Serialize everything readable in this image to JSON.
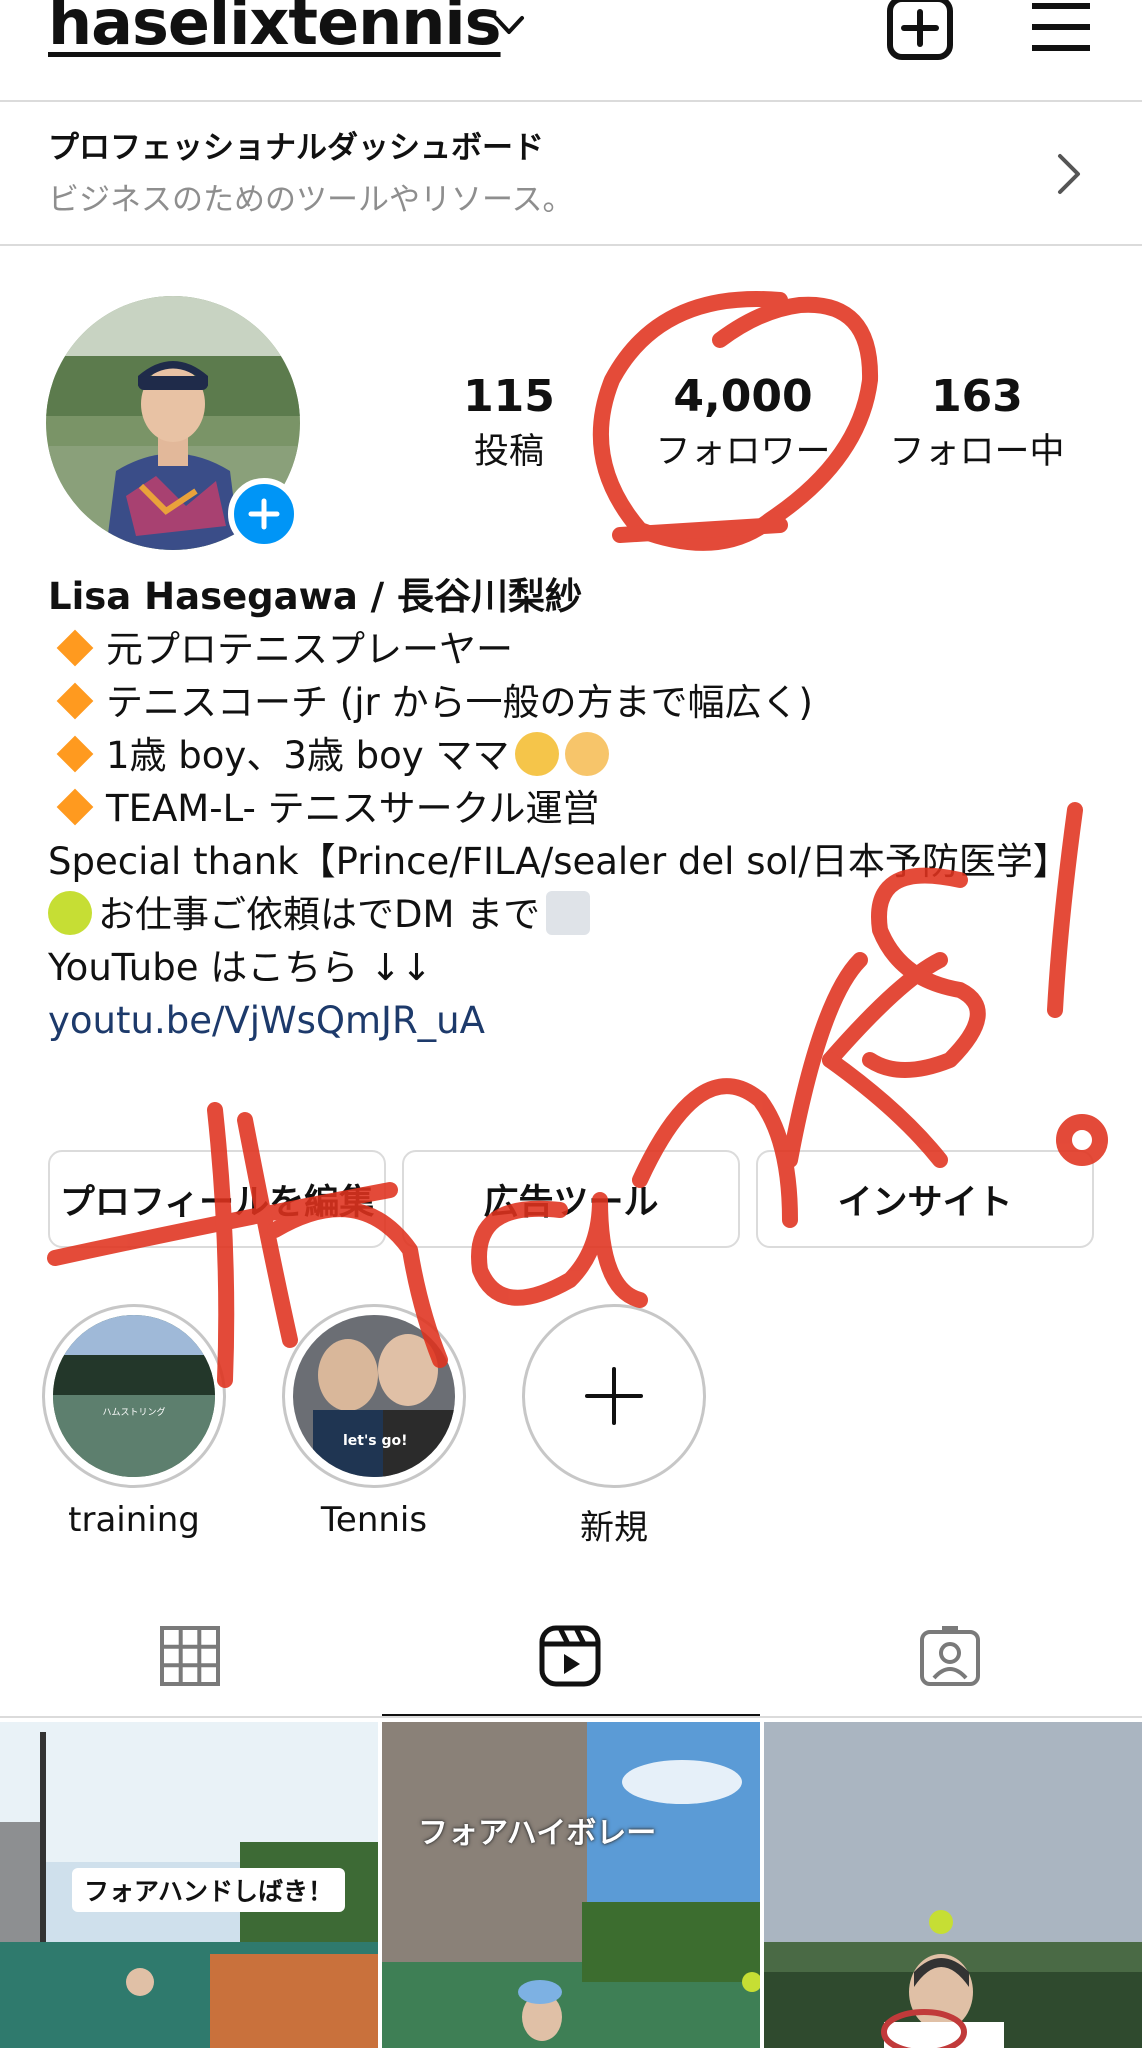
{
  "header": {
    "username": "haselixtennis",
    "icons": [
      "chevron-down-icon",
      "new-post-icon",
      "menu-icon"
    ]
  },
  "dashboard": {
    "title": "プロフェッショナルダッシュボード",
    "subtitle": "ビジネスのためのツールやリソース。"
  },
  "stats": {
    "posts": {
      "value": "115",
      "label": "投稿"
    },
    "followers": {
      "value": "4,000",
      "label": "フォロワー"
    },
    "following": {
      "value": "163",
      "label": "フォロー中"
    }
  },
  "bio": {
    "name": "Lisa Hasegawa / 長谷川梨紗",
    "line1": "元プロテニスプレーヤー",
    "line2": "テニスコーチ (jr から一般の方まで幅広く)",
    "line3": "1歳 boy、3歳 boy ママ",
    "line4": "TEAM-L- テニスサークル運営",
    "line5": "Special thank【Prince/FILA/sealer del sol/日本予防医学】",
    "line6": "お仕事ご依頼はでDM まで",
    "line7": "YouTube はこちら ↓↓",
    "link": "youtu.be/VjWsQmJR_uA"
  },
  "buttons": {
    "edit": "プロフィールを編集",
    "ads": "広告ツール",
    "insights": "インサイト"
  },
  "highlights": [
    {
      "label": "training"
    },
    {
      "label": "Tennis"
    },
    {
      "label": "新規"
    }
  ],
  "tabs": [
    "grid-icon",
    "reels-icon",
    "tagged-icon"
  ],
  "reels": [
    {
      "caption": "フォアハンドしばき！"
    },
    {
      "caption": "フォアハイボレー"
    },
    {
      "caption": ""
    }
  ],
  "overlay": {
    "handwriting": "Thanks!",
    "color": "#e0321e"
  },
  "colors": {
    "accent_blue": "#0095f6",
    "link": "#1d3a6b",
    "muted": "#8e8e8e",
    "border": "#dbdbdb"
  }
}
